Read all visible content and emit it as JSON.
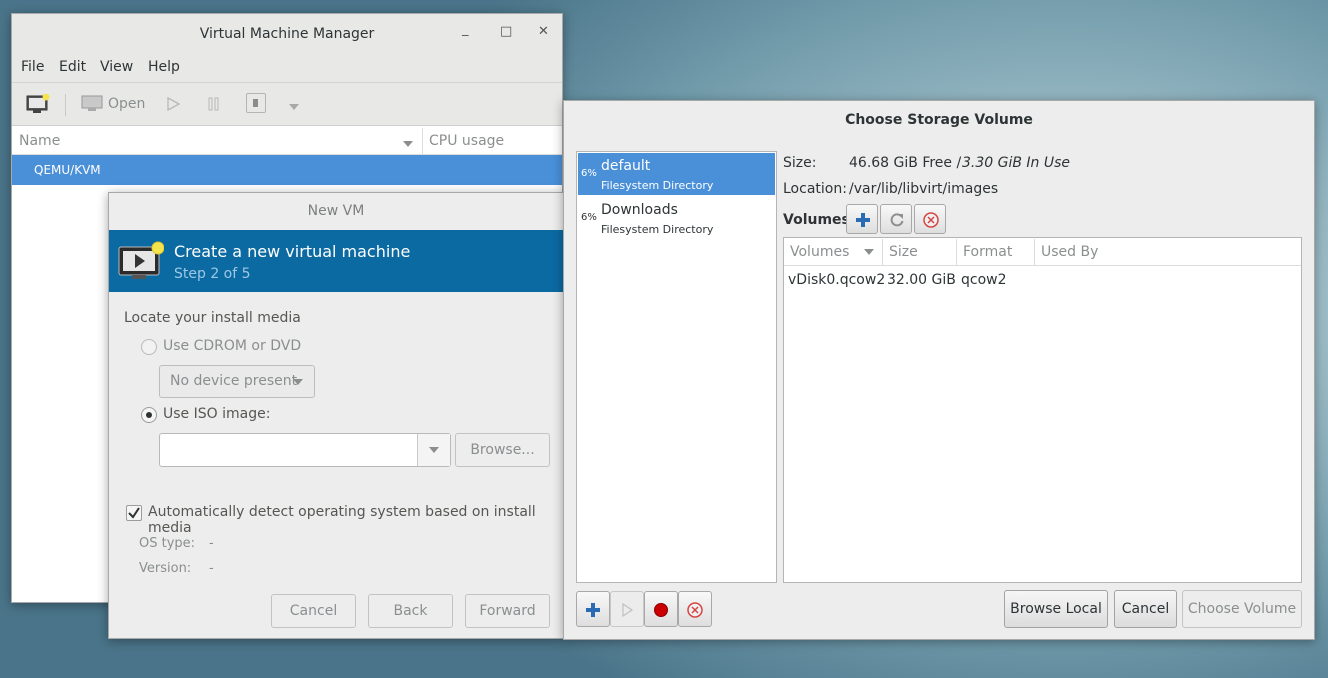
{
  "vmm": {
    "title": "Virtual Machine Manager",
    "menu": [
      "File",
      "Edit",
      "View",
      "Help"
    ],
    "toolbar": {
      "open_label": "Open"
    },
    "columns": {
      "name": "Name",
      "cpu": "CPU usage"
    },
    "connection": "QEMU/KVM"
  },
  "newvm": {
    "title": "New VM",
    "header_title": "Create a new virtual machine",
    "header_step": "Step 2 of 5",
    "locate_label": "Locate your install media",
    "cdrom_label": "Use CDROM or DVD",
    "device_select": "No device present",
    "iso_label": "Use ISO image:",
    "iso_value": "",
    "browse_label": "Browse...",
    "autodetect_label": "Automatically detect operating system based on install media",
    "os_type_label": "OS type:",
    "os_type_value": "-",
    "version_label": "Version:",
    "version_value": "-",
    "cancel_label": "Cancel",
    "back_label": "Back",
    "forward_label": "Forward"
  },
  "storage": {
    "title": "Choose Storage Volume",
    "pools": [
      {
        "usage": "6%",
        "name": "default",
        "type": "Filesystem Directory",
        "selected": true
      },
      {
        "usage": "6%",
        "name": "Downloads",
        "type": "Filesystem Directory",
        "selected": false
      }
    ],
    "size_label": "Size:",
    "size_free": "46.68 GiB Free / ",
    "size_used": "3.30 GiB In Use",
    "location_label": "Location:",
    "location_value": "/var/lib/libvirt/images",
    "volumes_label": "Volumes",
    "table_headers": [
      "Volumes",
      "Size",
      "Format",
      "Used By"
    ],
    "volumes": [
      {
        "name": "vDisk0.qcow2",
        "size": "32.00 GiB",
        "format": "qcow2",
        "used_by": ""
      }
    ],
    "browse_local_label": "Browse Local",
    "cancel_label": "Cancel",
    "choose_label": "Choose Volume"
  },
  "colors": {
    "selection": "#4a90d9",
    "header_blue": "#0b6aa2",
    "stop_red": "#cc0000"
  }
}
